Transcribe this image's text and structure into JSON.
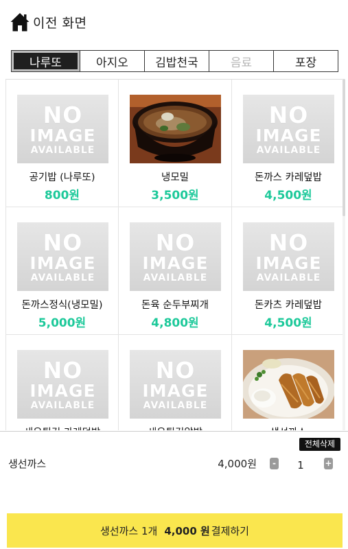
{
  "header": {
    "back_label": "이전 화면",
    "home_icon": "home-icon"
  },
  "tabs": [
    {
      "label": "나루또",
      "state": "active"
    },
    {
      "label": "아지오",
      "state": "normal"
    },
    {
      "label": "김밥천국",
      "state": "normal"
    },
    {
      "label": "음료",
      "state": "disabled"
    },
    {
      "label": "포장",
      "state": "normal"
    }
  ],
  "menu": {
    "no_image": {
      "line1": "NO",
      "line2": "IMAGE",
      "line3": "AVAILABLE"
    },
    "items": [
      {
        "name": "공기밥 (나루또)",
        "price": "800원",
        "image": "none"
      },
      {
        "name": "냉모밀",
        "price": "3,500원",
        "image": "noodle-photo"
      },
      {
        "name": "돈까스 카레덮밥",
        "price": "4,500원",
        "image": "none"
      },
      {
        "name": "돈까스정식(냉모밀)",
        "price": "5,000원",
        "image": "none"
      },
      {
        "name": "돈육 순두부찌개",
        "price": "4,800원",
        "image": "none"
      },
      {
        "name": "돈카츠 카레덮밥",
        "price": "4,500원",
        "image": "none"
      },
      {
        "name": "새우튀김 카레덮밥",
        "price": "",
        "image": "none"
      },
      {
        "name": "새우튀김알밥",
        "price": "",
        "image": "none"
      },
      {
        "name": "생선까스",
        "price": "",
        "image": "fish-cutlet-photo"
      }
    ]
  },
  "cart": {
    "clear_label": "전체삭제",
    "items": [
      {
        "name": "생선까스",
        "price": "4,000원",
        "qty": "1"
      }
    ],
    "minus_label": "-",
    "plus_label": "+"
  },
  "checkout": {
    "summary": "생선까스 1개",
    "total": "4,000 원",
    "action": "결제하기"
  },
  "colors": {
    "price": "#1dc99a",
    "checkout_bg": "#fae64e",
    "active_tab_bg": "#1f1f1f",
    "disabled_tab_text": "#b5b5b5"
  }
}
